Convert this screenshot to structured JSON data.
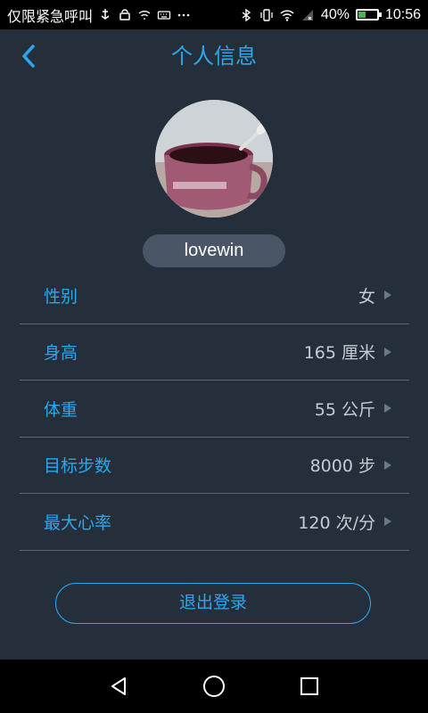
{
  "status_bar": {
    "carrier": "仅限紧急呼叫",
    "battery_percent": "40%",
    "battery_level": 0.4,
    "time": "10:56",
    "icons": [
      "usb-icon",
      "android-debug-icon",
      "wifi-calling-icon",
      "keyboard-icon",
      "more-icon",
      "bluetooth-icon",
      "vibrate-icon",
      "wifi-icon",
      "signal-icon",
      "battery-icon"
    ]
  },
  "header": {
    "title": "个人信息",
    "back_icon": "chevron-left-icon"
  },
  "profile": {
    "username": "lovewin"
  },
  "info_rows": [
    {
      "label": "性别",
      "value": "女"
    },
    {
      "label": "身高",
      "value": "165 厘米"
    },
    {
      "label": "体重",
      "value": "55 公斤"
    },
    {
      "label": "目标步数",
      "value": "8000 步"
    },
    {
      "label": "最大心率",
      "value": "120 次/分"
    }
  ],
  "actions": {
    "logout_label": "退出登录"
  },
  "colors": {
    "background": "#252f3c",
    "accent": "#2aa8ee",
    "value_text": "#c5cbd4",
    "divider": "#5a6677",
    "pill": "#4a5566"
  }
}
